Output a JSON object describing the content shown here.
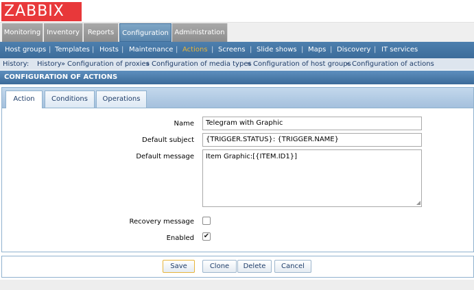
{
  "logo": "ZABBIX",
  "main_menu": [
    "Monitoring",
    "Inventory",
    "Reports",
    "Configuration",
    "Administration"
  ],
  "main_menu_active": "Configuration",
  "sub_menu": [
    "Host groups",
    "Templates",
    "Hosts",
    "Maintenance",
    "Actions",
    "Screens",
    "Slide shows",
    "Maps",
    "Discovery",
    "IT services"
  ],
  "sub_menu_active": "Actions",
  "history": {
    "label": "History:",
    "items": [
      "History",
      "Configuration of proxies",
      "Configuration of media types",
      "Configuration of host groups",
      "Configuration of actions"
    ],
    "separator": "»"
  },
  "section_title": "CONFIGURATION OF ACTIONS",
  "tabs": [
    "Action",
    "Conditions",
    "Operations"
  ],
  "tab_active": "Action",
  "form": {
    "name_label": "Name",
    "name_value": "Telegram with Graphic",
    "subject_label": "Default subject",
    "subject_value": "{TRIGGER.STATUS}: {TRIGGER.NAME}",
    "message_label": "Default message",
    "message_value": "Item Graphic:[{ITEM.ID1}]",
    "recovery_label": "Recovery message",
    "recovery_checked": false,
    "enabled_label": "Enabled",
    "enabled_checked": true
  },
  "buttons": {
    "save": "Save",
    "clone": "Clone",
    "delete": "Delete",
    "cancel": "Cancel"
  },
  "colors": {
    "logo_bg": "#e8383a",
    "sub_menu_bg": "#3c6c9a",
    "active_menu_text": "#e7b43a",
    "header_bg": "#4a7aab"
  },
  "icons": {
    "check": "checkmark-icon",
    "resize": "resize-grip-icon"
  }
}
